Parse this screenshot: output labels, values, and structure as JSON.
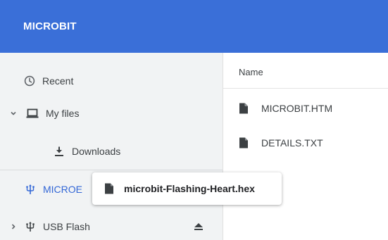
{
  "header": {
    "title": "MICROBIT"
  },
  "sidebar": {
    "items": [
      {
        "label": "Recent",
        "icon": "clock-icon"
      },
      {
        "label": "My files",
        "icon": "laptop-icon",
        "expanded": true
      },
      {
        "label": "Downloads",
        "icon": "download-icon"
      },
      {
        "label": "MICROBIT",
        "icon": "usb-icon",
        "active": true,
        "visible_text": "MICROE"
      },
      {
        "label": "USB Flash",
        "icon": "usb-icon",
        "expanded": false,
        "eject_icon": "eject-icon"
      }
    ]
  },
  "main": {
    "column_header": "Name",
    "files": [
      {
        "name": "MICROBIT.HTM",
        "icon": "file-icon"
      },
      {
        "name": "DETAILS.TXT",
        "icon": "file-icon"
      }
    ]
  },
  "drag": {
    "file_name": "microbit-Flashing-Heart.hex",
    "icon": "file-icon"
  },
  "colors": {
    "header_bg": "#3a6fd8",
    "sidebar_bg": "#f1f3f4",
    "active_text": "#3367d6"
  }
}
